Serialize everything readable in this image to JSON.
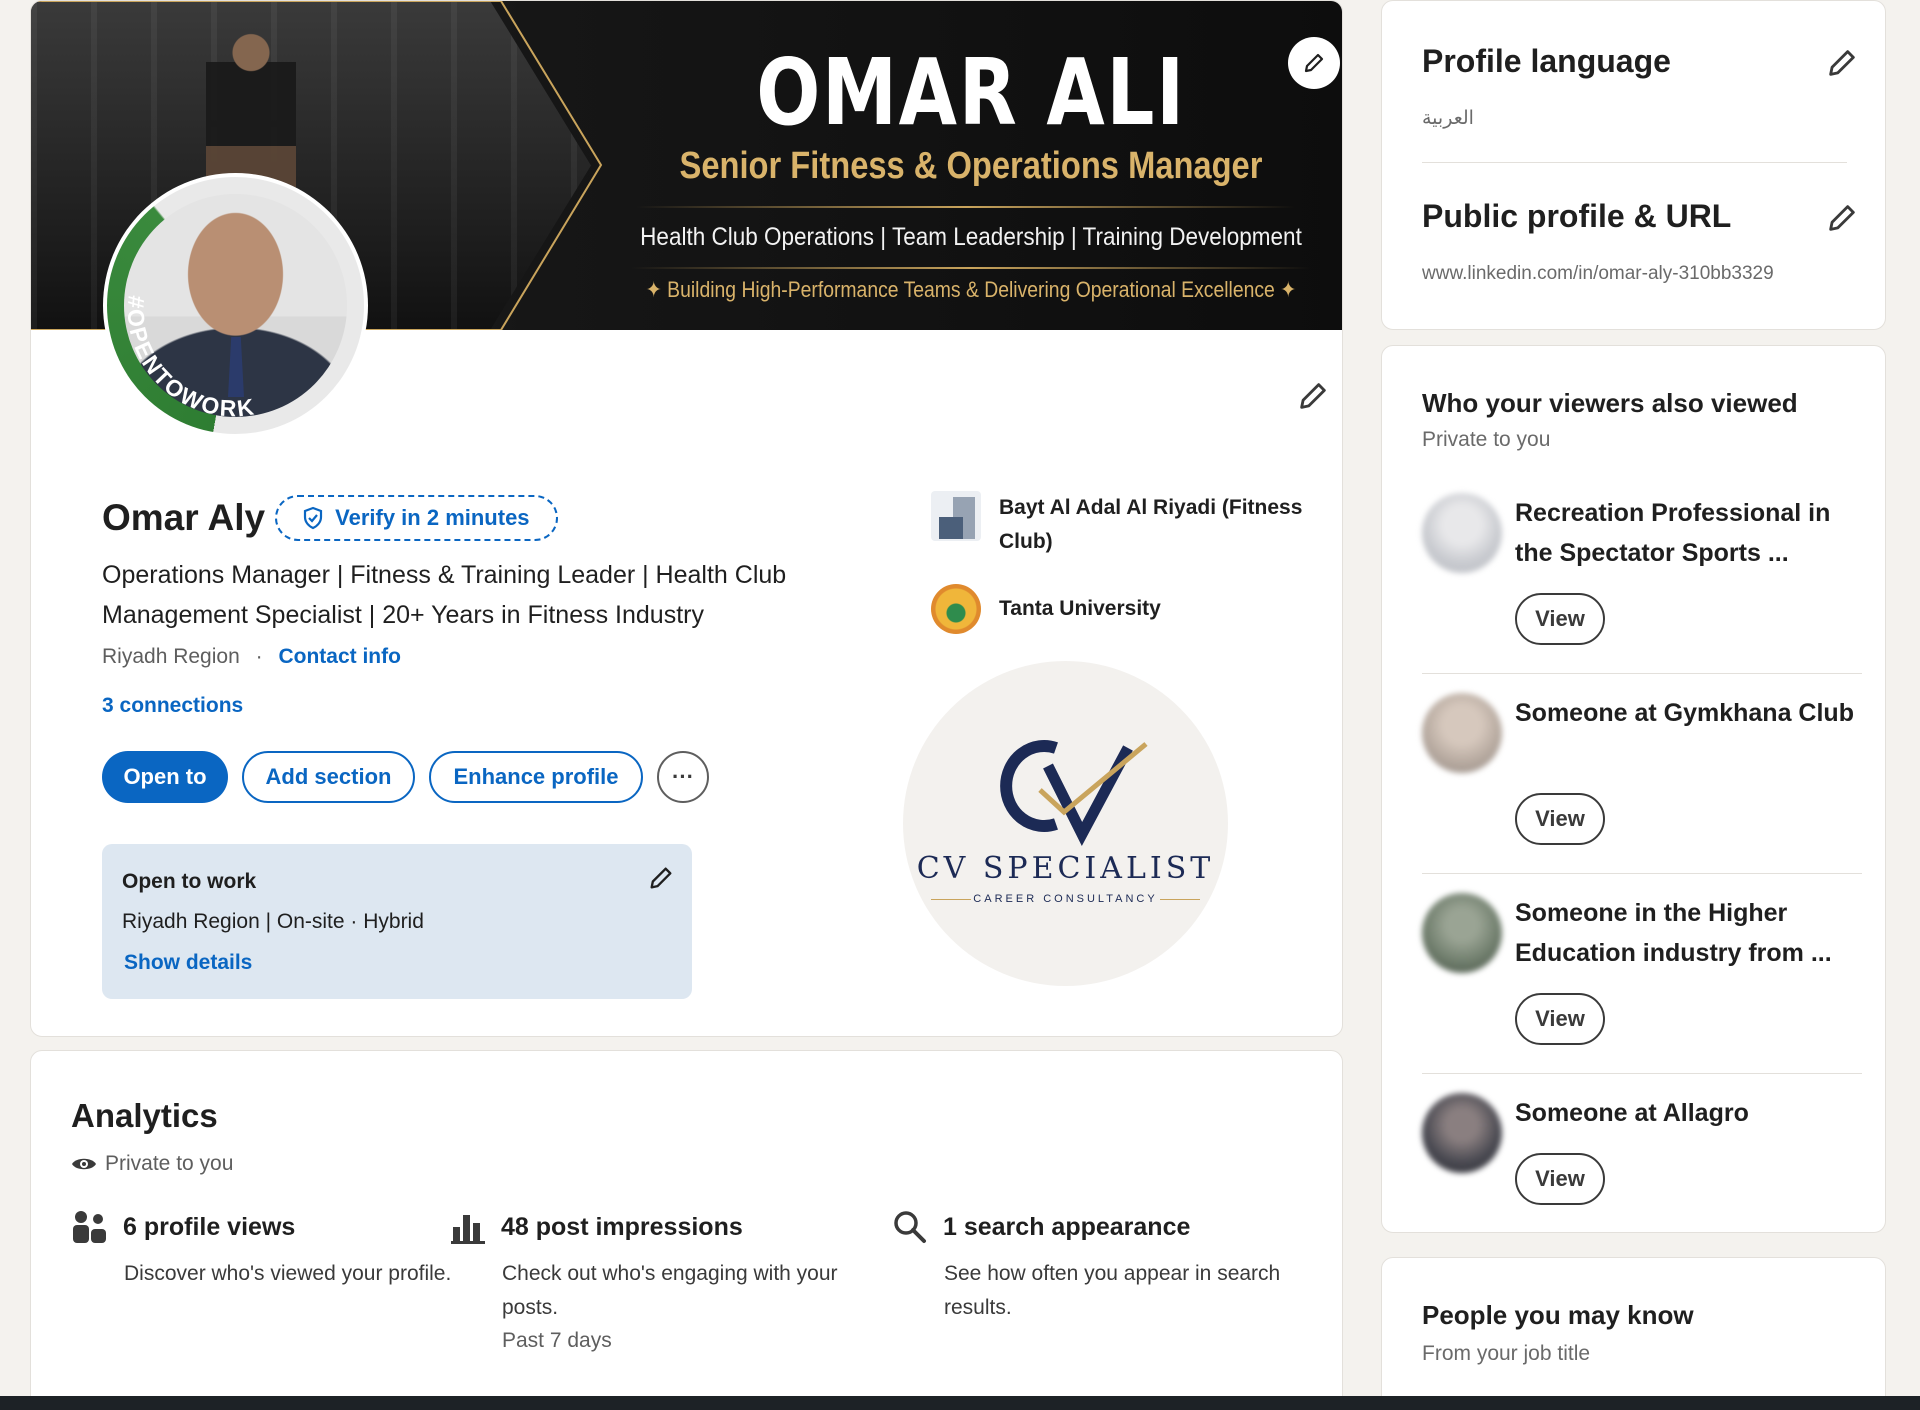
{
  "banner": {
    "name": "OMAR ALI",
    "title": "Senior Fitness & Operations Manager",
    "specialties": "Health Club Operations  |  Team Leadership  |  Training Development",
    "tagline": "✦  Building High-Performance Teams & Delivering Operational Excellence  ✦"
  },
  "avatar": {
    "ring_text": "#OPENTOWORK"
  },
  "profile": {
    "name": "Omar Aly",
    "verify_label": "Verify in 2 minutes",
    "headline": "Operations Manager | Fitness & Training Leader | Health Club Management Specialist | 20+ Years in Fitness Industry",
    "location": "Riyadh Region",
    "separator": "·",
    "contact_info": "Contact info",
    "connections": "3 connections"
  },
  "actions": {
    "open_to": "Open to",
    "add_section": "Add section",
    "enhance_profile": "Enhance profile",
    "more": "···"
  },
  "open_to_work": {
    "title": "Open to work",
    "detail": "Riyadh Region | On-site · Hybrid",
    "show_details": "Show details"
  },
  "experience": {
    "company": "Bayt Al Adal Al Riyadi (Fitness Club)",
    "school": "Tanta University"
  },
  "cv_logo": {
    "name": "CV SPECIALIST",
    "sub": "CAREER CONSULTANCY"
  },
  "analytics": {
    "title": "Analytics",
    "private": "Private to you",
    "metrics": [
      {
        "title": "6 profile views",
        "desc": "Discover who's viewed your profile.",
        "foot": ""
      },
      {
        "title": "48 post impressions",
        "desc": "Check out who's engaging with your posts.",
        "foot": "Past 7 days"
      },
      {
        "title": "1 search appearance",
        "desc": "See how often you appear in search results.",
        "foot": ""
      }
    ]
  },
  "rail": {
    "profile_language": {
      "title": "Profile language",
      "value": "العربية"
    },
    "public_profile": {
      "title": "Public profile & URL",
      "value": "www.linkedin.com/in/omar-aly-310bb3329"
    },
    "viewers": {
      "title": "Who your viewers also viewed",
      "sub": "Private to you",
      "view_label": "View",
      "items": [
        {
          "name": "Recreation Professional in the Spectator Sports ...",
          "color": "#c9cbd0"
        },
        {
          "name": "Someone at Gymkhana Club",
          "color": "#b7aaa0"
        },
        {
          "name": "Someone in the Higher Education industry from ...",
          "color": "#6f7d6c"
        },
        {
          "name": "Someone at Allagro",
          "color": "#4a4a52"
        }
      ]
    },
    "pymk": {
      "title": "People you may know",
      "sub": "From your job title"
    }
  },
  "colors": {
    "accent": "#0a66c2",
    "gold": "#d9b36a",
    "open_to_work_green": "#2e7d32"
  }
}
